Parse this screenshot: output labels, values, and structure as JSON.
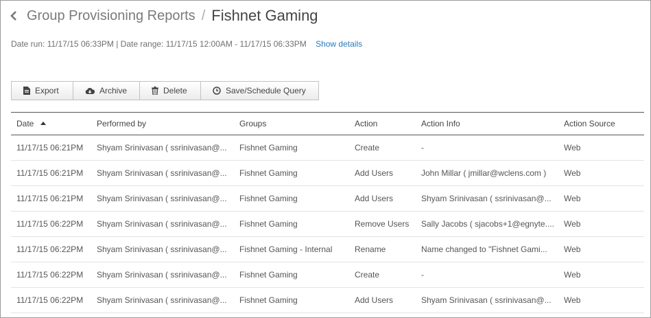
{
  "breadcrumb": {
    "parent": "Group Provisioning Reports",
    "separator": "/",
    "current": "Fishnet Gaming"
  },
  "meta": {
    "text": "Date run: 11/17/15 06:33PM | Date range: 11/17/15 12:00AM - 11/17/15 06:33PM",
    "link": "Show details"
  },
  "toolbar": {
    "export": "Export",
    "archive": "Archive",
    "delete": "Delete",
    "save_schedule": "Save/Schedule Query"
  },
  "table": {
    "headers": [
      "Date",
      "Performed by",
      "Groups",
      "Action",
      "Action Info",
      "Action Source"
    ],
    "sort_column": "Date",
    "sort_direction": "ascending",
    "rows": [
      [
        "11/17/15 06:21PM",
        "Shyam Srinivasan ( ssrinivasan@...",
        "Fishnet Gaming",
        "Create",
        "-",
        "Web"
      ],
      [
        "11/17/15 06:21PM",
        "Shyam Srinivasan ( ssrinivasan@...",
        "Fishnet Gaming",
        "Add Users",
        "John Millar ( jmillar@wclens.com )",
        "Web"
      ],
      [
        "11/17/15 06:21PM",
        "Shyam Srinivasan ( ssrinivasan@...",
        "Fishnet Gaming",
        "Add Users",
        "Shyam Srinivasan ( ssrinivasan@...",
        "Web"
      ],
      [
        "11/17/15 06:22PM",
        "Shyam Srinivasan ( ssrinivasan@...",
        "Fishnet Gaming",
        "Remove Users",
        "Sally Jacobs ( sjacobs+1@egnyte....",
        "Web"
      ],
      [
        "11/17/15 06:22PM",
        "Shyam Srinivasan ( ssrinivasan@...",
        "Fishnet Gaming - Internal",
        "Rename",
        "Name changed to \"Fishnet Gami...",
        "Web"
      ],
      [
        "11/17/15 06:22PM",
        "Shyam Srinivasan ( ssrinivasan@...",
        "Fishnet Gaming",
        "Create",
        "-",
        "Web"
      ],
      [
        "11/17/15 06:22PM",
        "Shyam Srinivasan ( ssrinivasan@...",
        "Fishnet Gaming",
        "Add Users",
        "Shyam Srinivasan ( ssrinivasan@...",
        "Web"
      ]
    ]
  }
}
